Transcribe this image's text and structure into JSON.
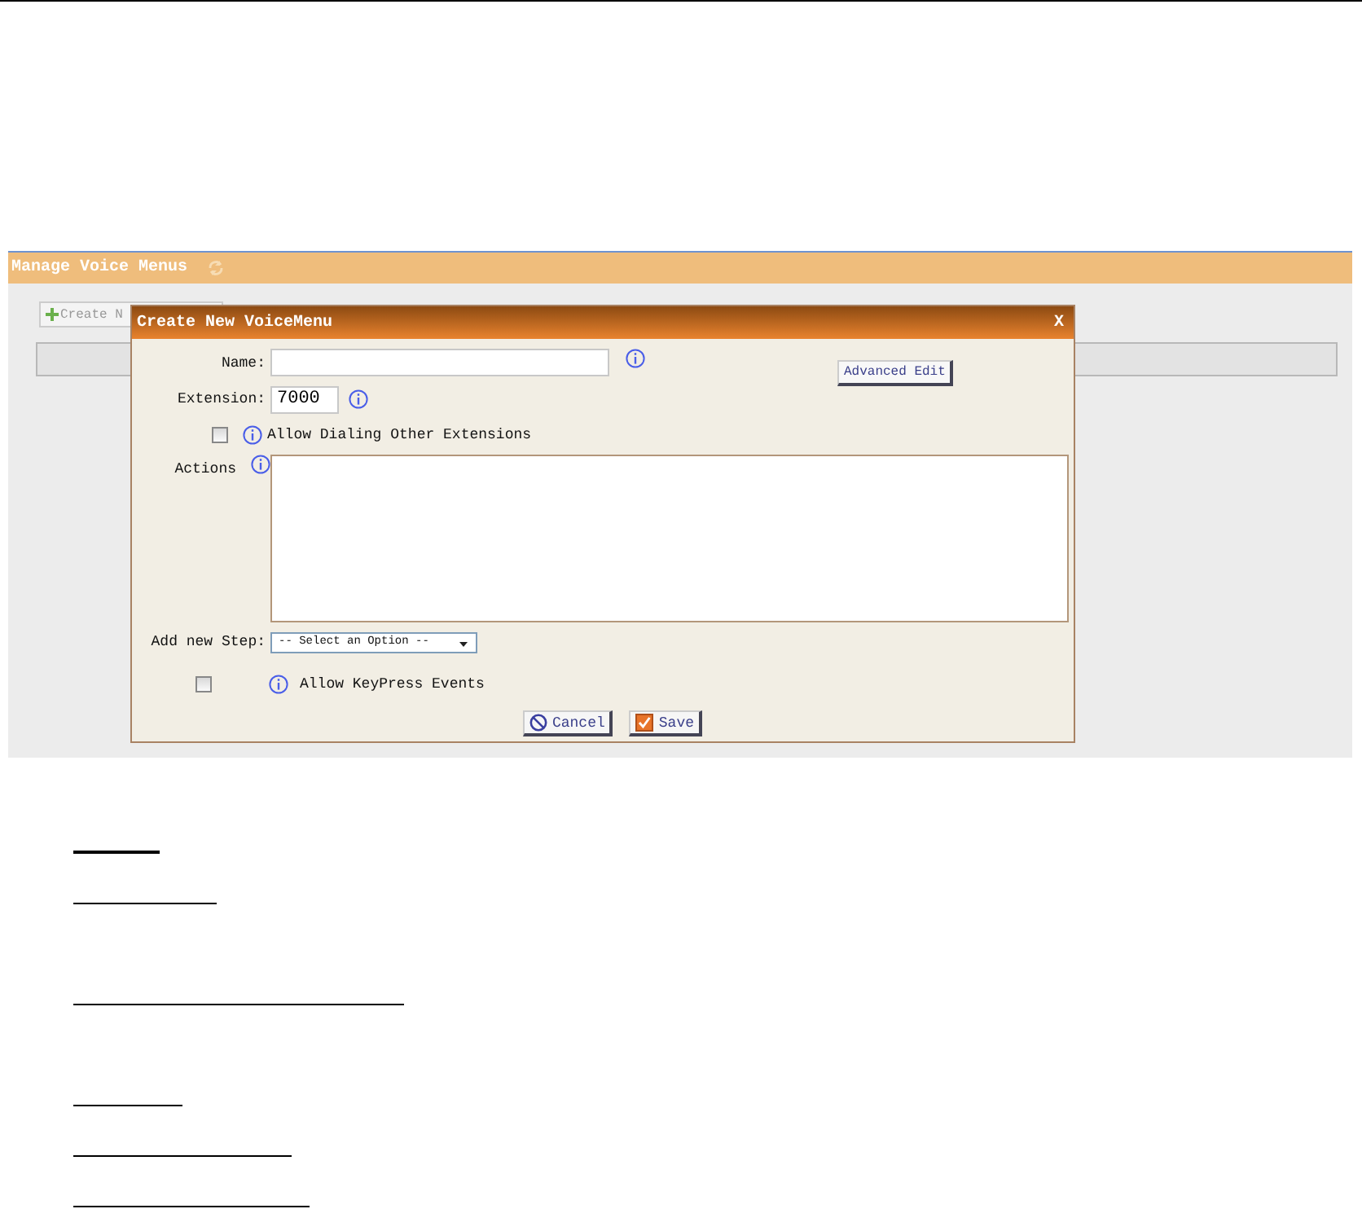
{
  "page_header": {
    "title": "Manage Voice Menus"
  },
  "create_button": {
    "label": "Create N"
  },
  "dialog": {
    "title": "Create New VoiceMenu",
    "close": "X",
    "advanced_button": "Advanced Edit",
    "name_field": {
      "label": "Name:"
    },
    "extension_field": {
      "label": "Extension:",
      "value": "7000"
    },
    "allow_dialing": {
      "label": "Allow Dialing Other Extensions",
      "checked": false
    },
    "actions_field": {
      "label": "Actions"
    },
    "step_select": {
      "label": "Add new Step:",
      "value": "-- Select an Option --"
    },
    "allow_keypress": {
      "label": "Allow KeyPress Events",
      "checked": false
    },
    "buttons": [
      {
        "kind": "cancel",
        "label": "Cancel"
      },
      {
        "kind": "save",
        "label": "Save"
      }
    ]
  }
}
